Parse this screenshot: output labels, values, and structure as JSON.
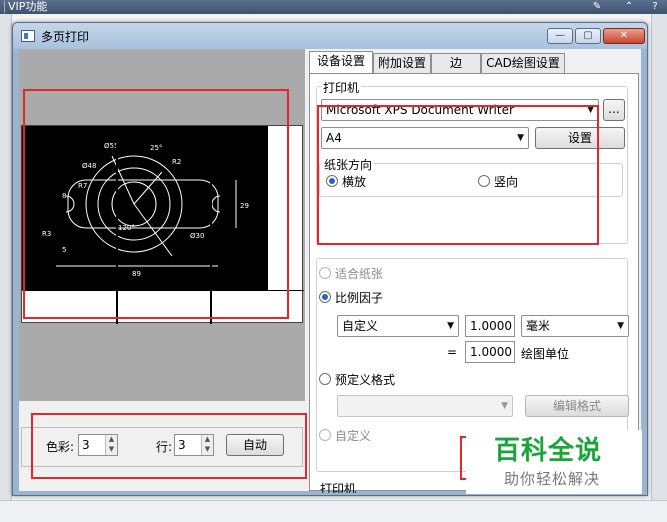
{
  "background_app": {
    "tab_label": "VIP功能"
  },
  "dialog": {
    "title": "多页打印"
  },
  "tabs": [
    {
      "label": "设备设置",
      "active": true
    },
    {
      "label": "附加设置",
      "active": false
    },
    {
      "label": "边",
      "active": false
    },
    {
      "label": "CAD绘图设置",
      "active": false
    }
  ],
  "printer_group": {
    "title": "打印机",
    "printer_name": "Microsoft XPS Document Writer",
    "browse_label": "...",
    "paper_size": "A4",
    "settings_button": "设置"
  },
  "orientation_group": {
    "title": "纸张方向",
    "landscape": "横放",
    "portrait": "竖向",
    "selected": "landscape"
  },
  "scale_group": {
    "fit_paper": "适合纸张",
    "scale_factor": "比例因子",
    "scale_mode": "自定义",
    "value1": "1.0000",
    "unit": "毫米",
    "equals": "=",
    "value2": "1.0000",
    "drawing_units": "绘图单位",
    "predefined_format": "预定义格式",
    "edit_format": "编辑格式",
    "custom": "自定义",
    "selected": "scale_factor"
  },
  "bottom_truncated_label": "打印机",
  "preview_drawing": {
    "labels": [
      "25°",
      "R2",
      "Ø55",
      "Ø48",
      "R7",
      "8",
      "29",
      "R3",
      "120°",
      "Ø30",
      "5",
      "89"
    ]
  },
  "preview_controls": {
    "color_label": "色彩:",
    "color_value": "3",
    "rows_label": "行:",
    "rows_value": "3",
    "auto_button": "自动"
  },
  "watermark": {
    "title": "百科全说",
    "subtitle": "助你轻松解决"
  },
  "colors": {
    "highlight": "#e0292d",
    "watermark_green": "#1aa53a"
  }
}
